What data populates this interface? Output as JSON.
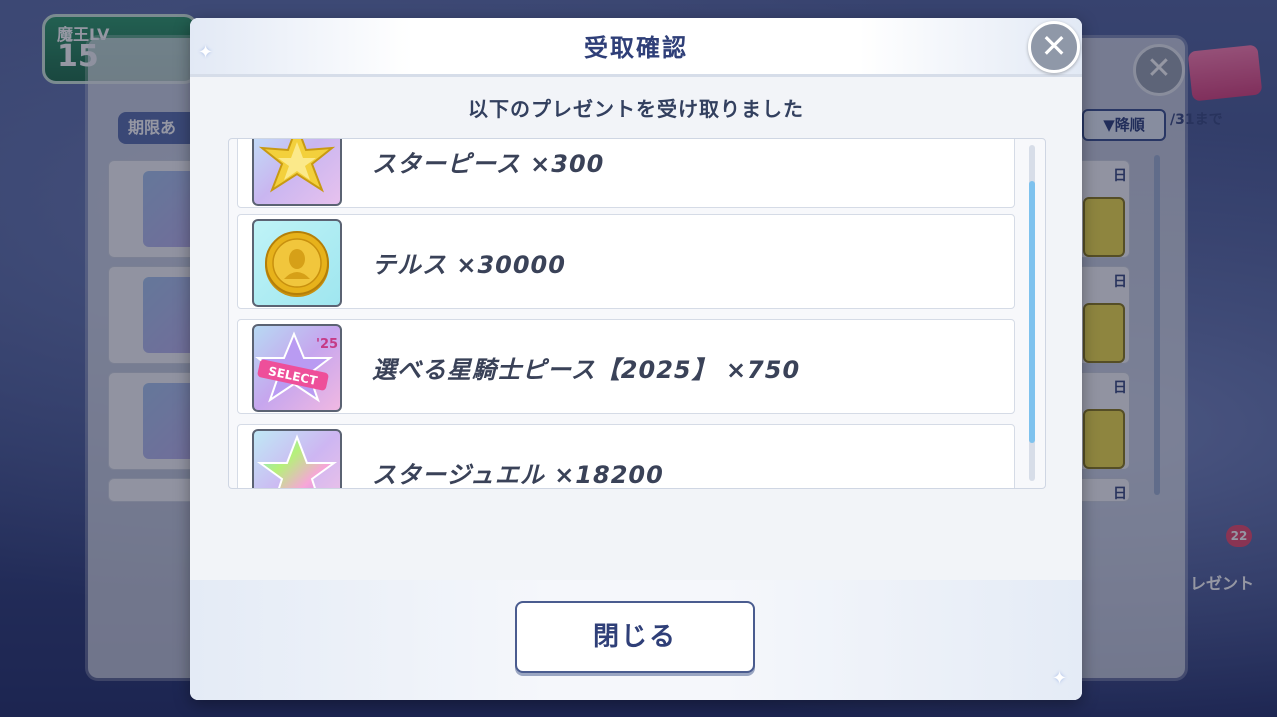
{
  "background": {
    "level_label": "魔王LV",
    "level_value": "15",
    "tab_label": "期限あ",
    "sort_label": "▼降順",
    "date_text": "/31まで",
    "day_marks": [
      "日",
      "日",
      "日",
      "日"
    ],
    "gift_badge": "22",
    "gift_label": "レゼント"
  },
  "dialog": {
    "title": "受取確認",
    "message": "以下のプレゼントを受け取りました",
    "close_glyph": "✕",
    "items": [
      {
        "label": "スターピース ×300",
        "icon": "star-piece-icon"
      },
      {
        "label": "テルス ×30000",
        "icon": "coin-icon"
      },
      {
        "label": "選べる星騎士ピース【2025】 ×750",
        "icon": "select-star-icon",
        "icon_text": "SELECT",
        "icon_year": "'25"
      },
      {
        "label": "スタージュエル ×18200",
        "icon": "rainbow-star-icon"
      }
    ],
    "close_button_label": "閉じる"
  },
  "colors": {
    "title": "#2f3f78",
    "button_border": "#4a5c8f",
    "scroll_thumb": "#7ec2ee",
    "coin_gold": "#e7b21b"
  }
}
